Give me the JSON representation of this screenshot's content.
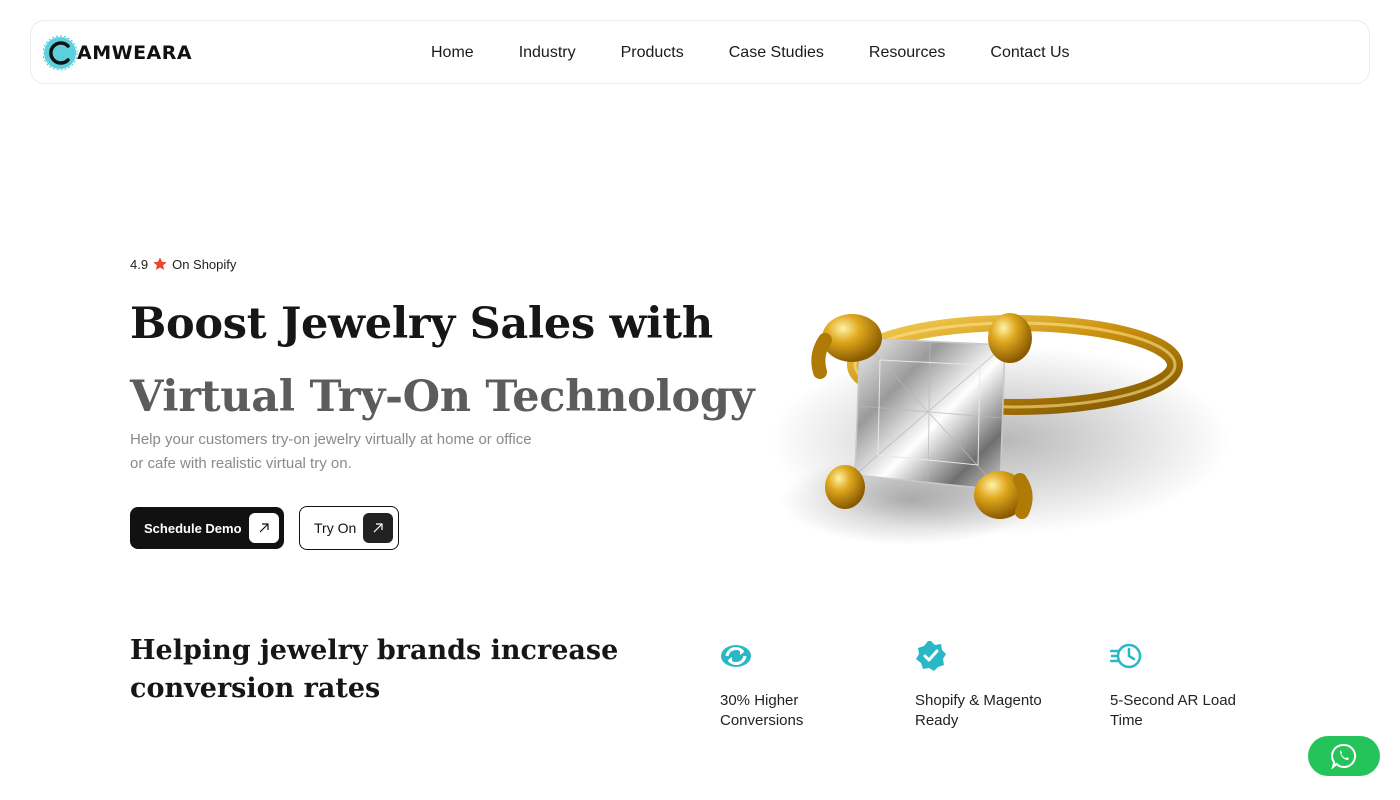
{
  "brand": {
    "name": "AMWEARA",
    "accent": "#3ec7d6"
  },
  "nav": {
    "items": [
      "Home",
      "Industry",
      "Products",
      "Case Studies",
      "Resources",
      "Contact Us"
    ]
  },
  "hero": {
    "rating_value": "4.9",
    "rating_source": "On Shopify",
    "star_color": "#e8452c",
    "headline_line1": "Boost Jewelry Sales with",
    "headline_line2": "Virtual Try-On Technology",
    "subtext": "Help your customers try-on jewelry virtually at home or office or cafe with realistic virtual try on.",
    "primary_button": "Schedule Demo",
    "secondary_button": "Try On"
  },
  "stats": {
    "tagline": "Helping jewelry brands increase conversion rates",
    "items": [
      {
        "icon": "refresh-arrows-icon",
        "label": "30% Higher Conversions"
      },
      {
        "icon": "verified-badge-icon",
        "label": "Shopify & Magento Ready"
      },
      {
        "icon": "fast-clock-icon",
        "label": "5-Second AR Load Time"
      }
    ],
    "icon_color": "#2bb8c6"
  },
  "whatsapp": {
    "icon": "whatsapp-icon",
    "color": "#25c45a"
  }
}
